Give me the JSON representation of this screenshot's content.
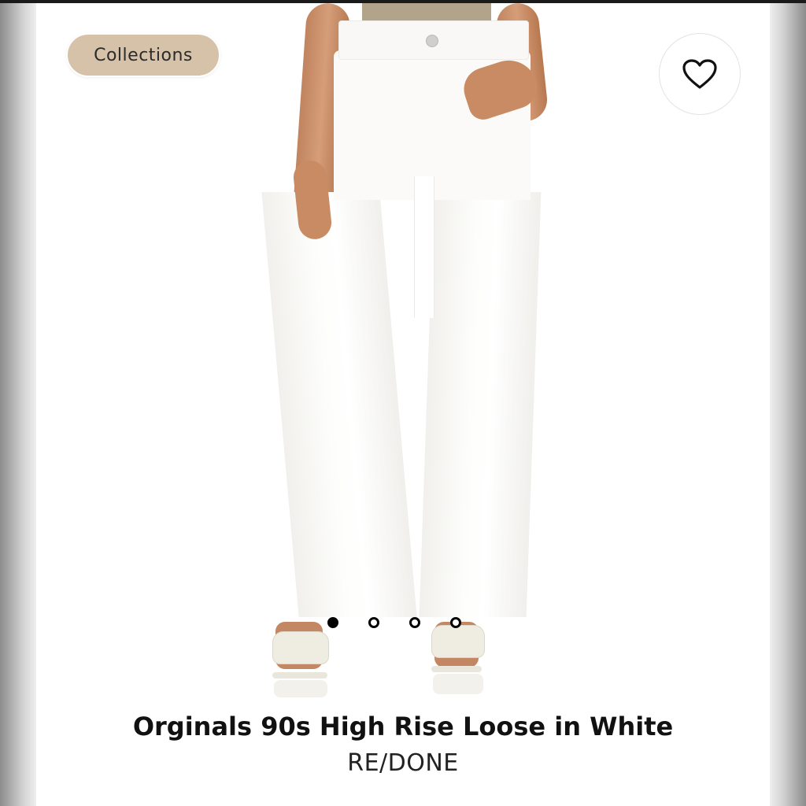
{
  "chip": {
    "label": "Collections"
  },
  "favorite": {
    "icon": "heart-icon"
  },
  "carousel": {
    "total": 4,
    "active_index": 1
  },
  "product": {
    "title": "Orginals 90s High Rise Loose in White",
    "brand": "RE/DONE"
  },
  "colors": {
    "chip_bg": "#d6c2a9",
    "text": "#111111",
    "page_bg": "#ffffff"
  }
}
